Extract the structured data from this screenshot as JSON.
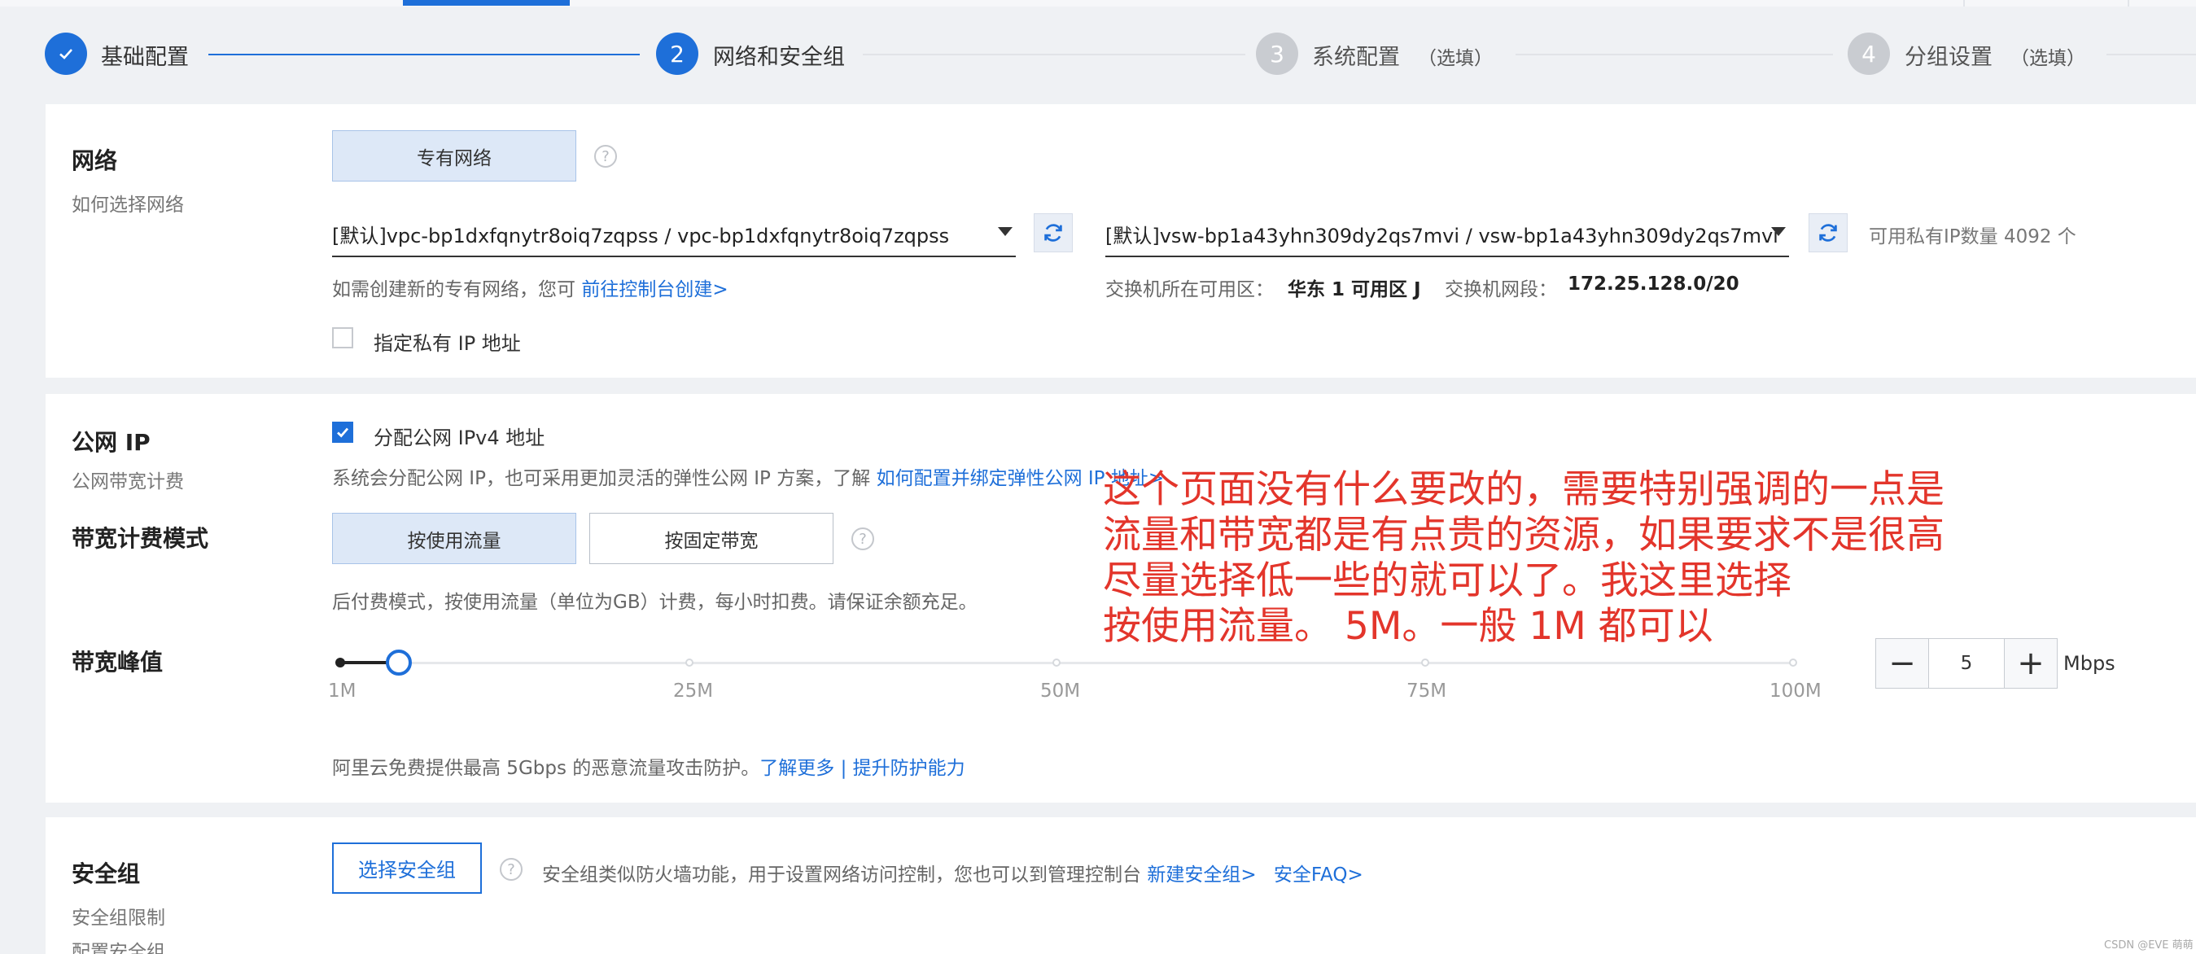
{
  "steps": [
    {
      "number": "",
      "label": "基础配置",
      "optional": ""
    },
    {
      "number": "2",
      "label": "网络和安全组",
      "optional": ""
    },
    {
      "number": "3",
      "label": "系统配置",
      "optional": "（选填）"
    },
    {
      "number": "4",
      "label": "分组设置",
      "optional": "（选填）"
    }
  ],
  "network": {
    "title": "网络",
    "subtitle": "如何选择网络",
    "type_button": "专有网络",
    "vpc_select": "[默认]vpc-bp1dxfqnytr8oiq7zqpss / vpc-bp1dxfqnytr8oiq7zqpss",
    "vswitch_select": "[默认]vsw-bp1a43yhn309dy2qs7mvi / vsw-bp1a43yhn309dy2qs7mvi",
    "available_ip": "可用私有IP数量 4092 个",
    "create_note": "如需创建新的专有网络，您可",
    "create_link": "前往控制台创建>",
    "zone_label": "交换机所在可用区：",
    "zone_value": "华东 1 可用区 J",
    "cidr_label": "交换机网段：",
    "cidr_value": "172.25.128.0/20",
    "private_ip_checkbox": "指定私有 IP 地址"
  },
  "public_ip": {
    "title": "公网 IP",
    "subtitle": "公网带宽计费",
    "assign_checkbox": "分配公网 IPv4 地址",
    "assign_checked": true,
    "note_prefix": "系统会分配公网 IP，也可采用更加灵活的弹性公网 IP 方案，了解",
    "note_link": "如何配置并绑定弹性公网 IP 地址>",
    "billing_title": "带宽计费模式",
    "billing_options": [
      "按使用流量",
      "按固定带宽"
    ],
    "billing_selected": 0,
    "billing_note": "后付费模式，按使用流量（单位为GB）计费，每小时扣费。请保证余额充足。",
    "bandwidth_title": "带宽峰值",
    "slider_ticks": [
      "1M",
      "25M",
      "50M",
      "75M",
      "100M"
    ],
    "slider_value": 5,
    "slider_min": 1,
    "slider_max": 100,
    "stepper_minus": "−",
    "stepper_value": "5",
    "stepper_plus": "+",
    "unit": "Mbps",
    "ddos_note": "阿里云免费提供最高 5Gbps 的恶意流量攻击防护。",
    "ddos_link1": "了解更多",
    "ddos_sep": " | ",
    "ddos_link2": "提升防护能力"
  },
  "security": {
    "title": "安全组",
    "sub1": "安全组限制",
    "sub2": "配置安全组",
    "select_button": "选择安全组",
    "note": "安全组类似防火墙功能，用于设置网络访问控制，您也可以到管理控制台",
    "link1": "新建安全组>",
    "link2": "安全FAQ>"
  },
  "annotation": {
    "lines": [
      "这个页面没有什么要改的，需要特别强调的一点是",
      "流量和带宽都是有点贵的资源，如果要求不是很高",
      "尽量选择低一些的就可以了。我这里选择",
      "按使用流量。 5M。一般 1M 都可以"
    ],
    "color": "#e3352b"
  },
  "watermark": "CSDN @EVE 萌萌",
  "colors": {
    "accent": "#1e6fd9"
  }
}
